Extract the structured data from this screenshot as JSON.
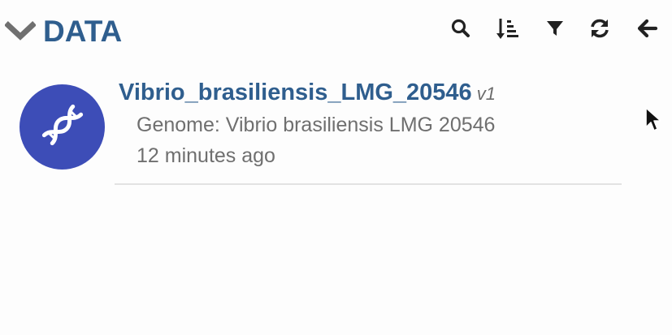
{
  "header": {
    "title": "DATA",
    "collapse_icon": "chevron-down-icon",
    "toolbar": [
      {
        "name": "search",
        "icon": "search-icon"
      },
      {
        "name": "sort",
        "icon": "sort-icon"
      },
      {
        "name": "filter",
        "icon": "filter-icon"
      },
      {
        "name": "refresh",
        "icon": "refresh-icon"
      },
      {
        "name": "back",
        "icon": "arrow-left-icon"
      }
    ]
  },
  "items": [
    {
      "icon": "dna-icon",
      "name": "Vibrio_brasiliensis_LMG_20546",
      "version": "v1",
      "type_line": "Genome: Vibrio brasiliensis LMG 20546",
      "time": "12 minutes ago"
    }
  ],
  "colors": {
    "title": "#2f5e8e",
    "avatar": "#3d4db7",
    "secondary_text": "#6f6f6f",
    "divider": "#e2e2e2"
  }
}
